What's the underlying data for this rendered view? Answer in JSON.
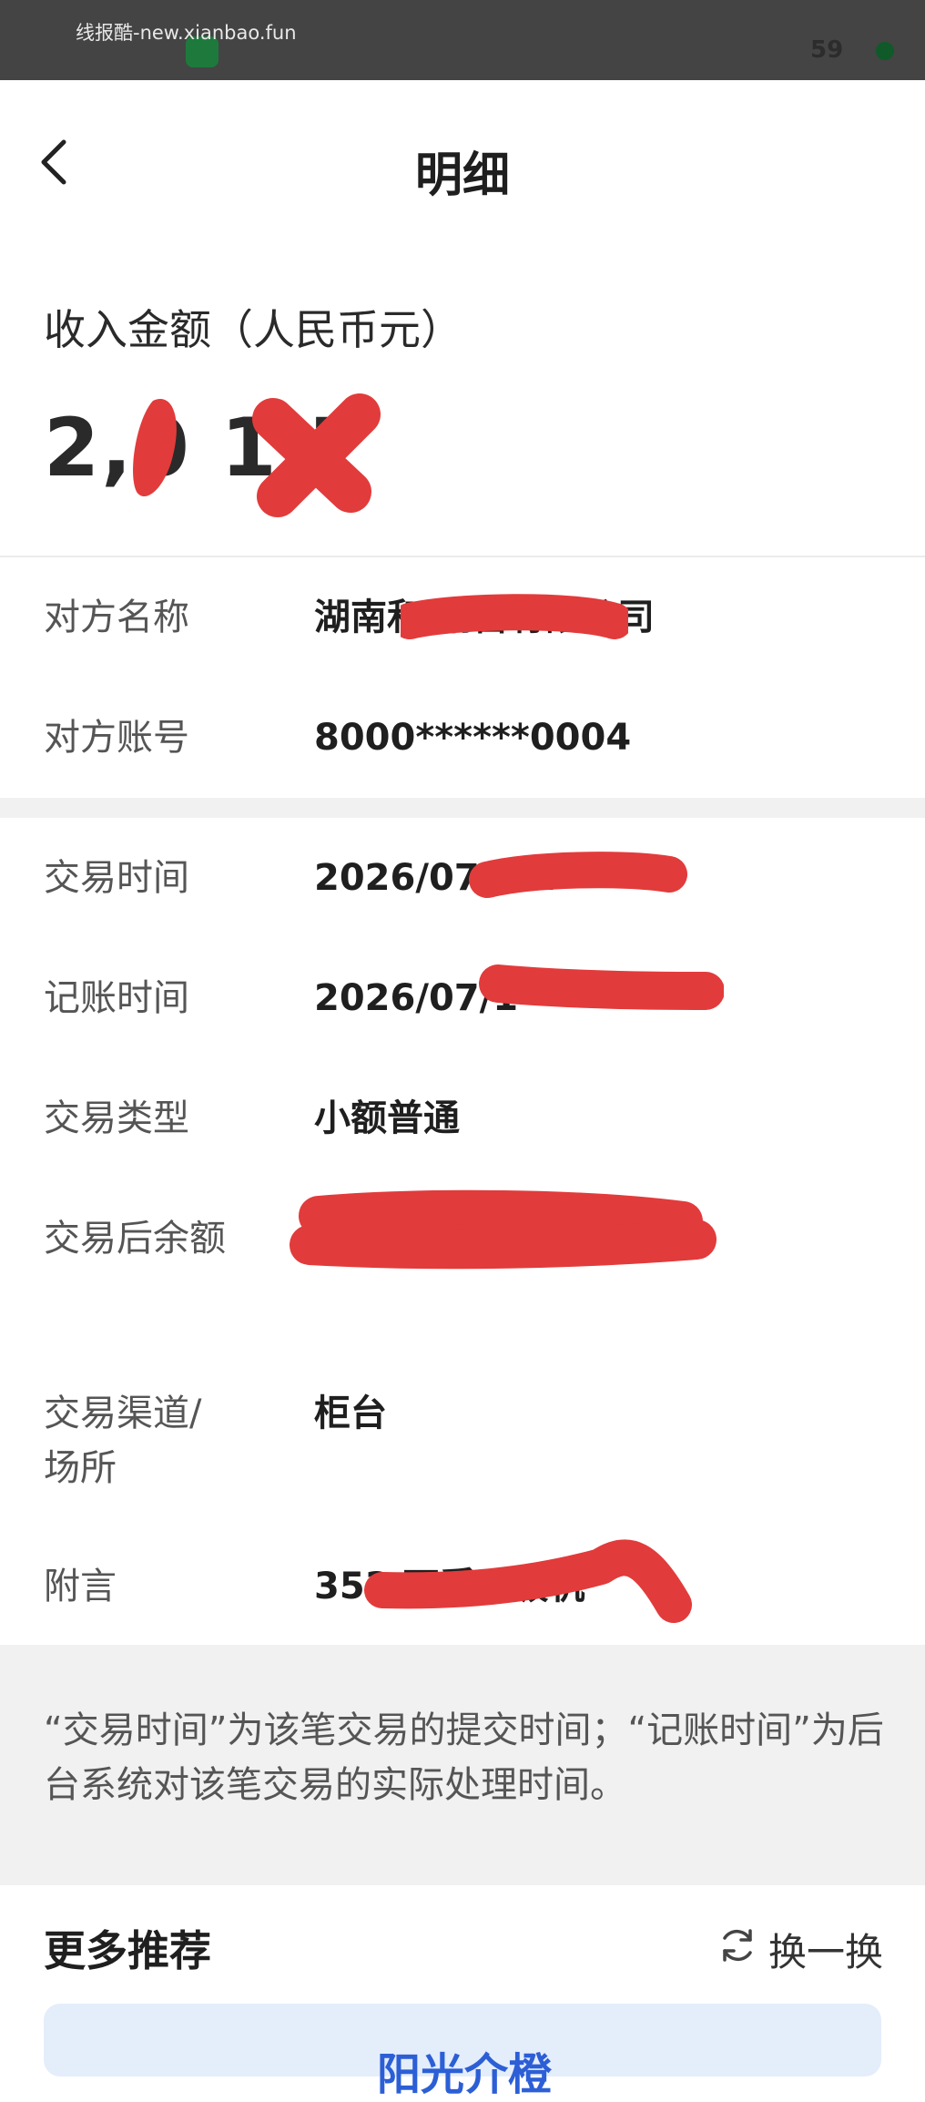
{
  "status_bar": {
    "watermark": "线报酷-new.xianbao.fun",
    "battery": "59"
  },
  "header": {
    "title": "明细",
    "back_icon": "chevron-left-icon"
  },
  "amount": {
    "label": "收入金额（人民币元）",
    "value_visible": "2,0  1.7"
  },
  "details": {
    "counterparty_name": {
      "label": "对方名称",
      "value": "湖南和          销售有限公司"
    },
    "counterparty_account": {
      "label": "对方账号",
      "value": "8000******0004"
    },
    "transaction_time": {
      "label": "交易时间",
      "value": "2026/07/          02"
    },
    "posting_time": {
      "label": "记账时间",
      "value": "2026/07/1"
    },
    "transaction_type": {
      "label": "交易类型",
      "value": "小额普通"
    },
    "balance_after": {
      "label": "交易后余额",
      "value": ""
    },
    "channel": {
      "label": "交易渠道/场所",
      "value": "柜台"
    },
    "note": {
      "label": "附言",
      "value": "353                 可孚呼吸机"
    }
  },
  "notice": "“交易时间”为该笔交易的提交时间；“记账时间”为后台系统对该笔交易的实际处理时间。",
  "more": {
    "title": "更多推荐",
    "refresh_label": "换一换",
    "refresh_icon": "refresh-icon",
    "card_text": "阳光介橙"
  },
  "colors": {
    "redaction": "#e23b3b",
    "statusbar": "#444444",
    "accent_blue": "#2c5fd6"
  }
}
